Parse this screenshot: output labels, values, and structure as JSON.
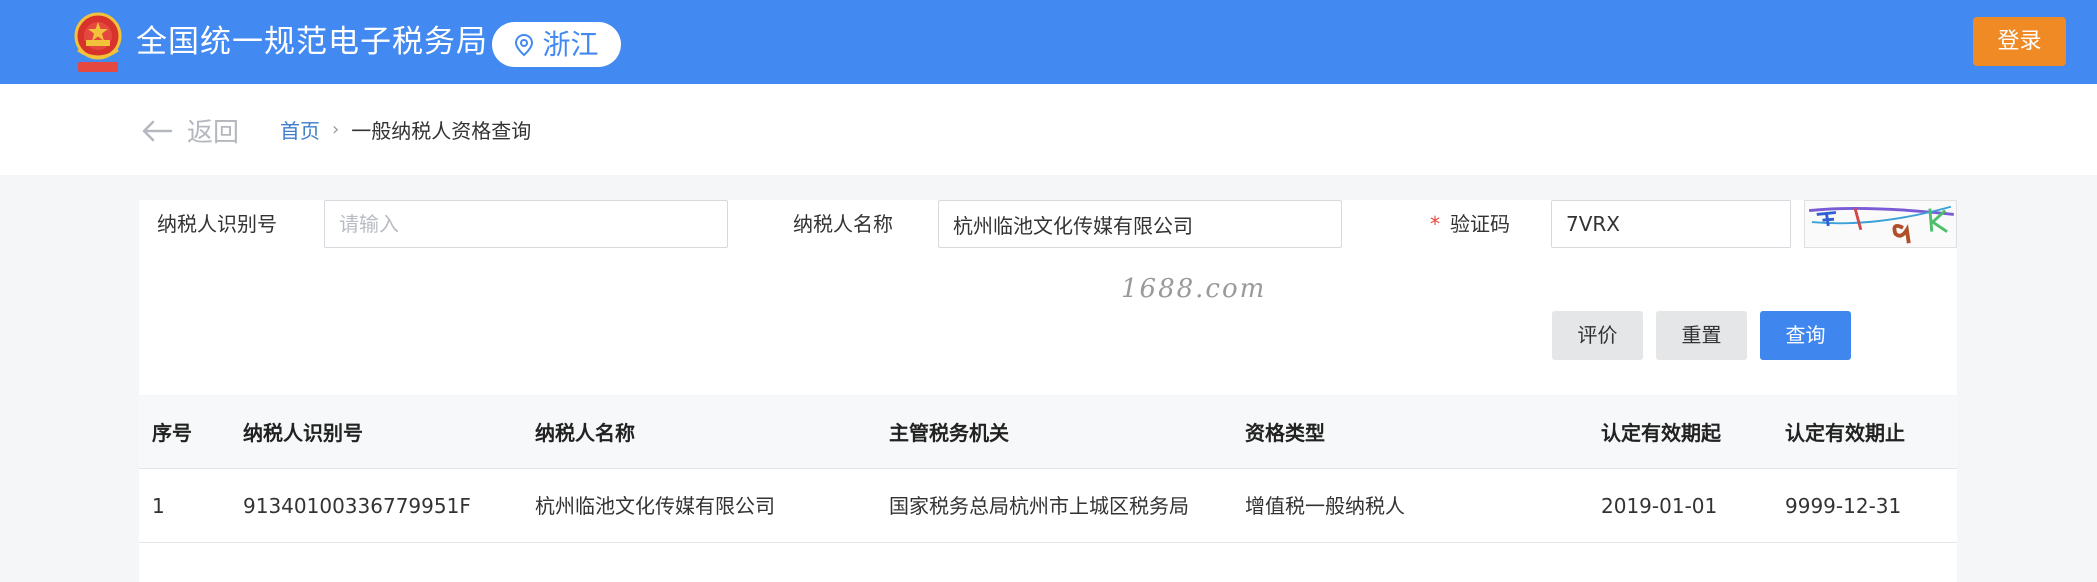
{
  "header": {
    "site_title": "全国统一规范电子税务局",
    "region": "浙江",
    "login_label": "登录",
    "brand_color": "#4289f1",
    "login_color": "#f08a25"
  },
  "nav": {
    "back_label": "返回",
    "breadcrumb_home": "首页",
    "breadcrumb_separator": "›",
    "breadcrumb_current": "一般纳税人资格查询"
  },
  "form": {
    "taxpayer_id_label": "纳税人识别号",
    "taxpayer_id_placeholder": "请输入",
    "taxpayer_id_value": "",
    "taxpayer_name_label": "纳税人名称",
    "taxpayer_name_value": "杭州临池文化传媒有限公司",
    "captcha_required_mark": "*",
    "captcha_label": "验证码",
    "captcha_value": "7VRX",
    "watermark_text": "1688.com",
    "buttons": {
      "evaluate": "评价",
      "reset": "重置",
      "query": "查询"
    }
  },
  "table": {
    "columns": [
      "序号",
      "纳税人识别号",
      "纳税人名称",
      "主管税务机关",
      "资格类型",
      "认定有效期起",
      "认定有效期止"
    ],
    "rows": [
      [
        "1",
        "91340100336779951F",
        "杭州临池文化传媒有限公司",
        "国家税务总局杭州市上城区税务局",
        "增值税一般纳税人",
        "2019-01-01",
        "9999-12-31"
      ]
    ]
  },
  "icons": {
    "emblem": "national-emblem-icon",
    "region_pin": "location-pin-icon",
    "back_arrow": "arrow-left-icon",
    "captcha": "captcha-image"
  }
}
